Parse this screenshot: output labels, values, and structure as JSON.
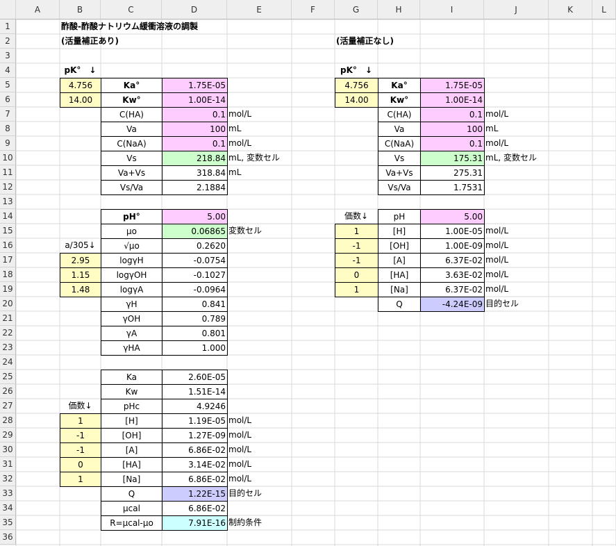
{
  "columns": [
    "A",
    "B",
    "C",
    "D",
    "E",
    "F",
    "G",
    "H",
    "I",
    "J",
    "K",
    "L"
  ],
  "rows": [
    "1",
    "2",
    "3",
    "4",
    "5",
    "6",
    "7",
    "8",
    "9",
    "10",
    "11",
    "12",
    "13",
    "14",
    "15",
    "16",
    "17",
    "18",
    "19",
    "20",
    "21",
    "22",
    "23",
    "24",
    "25",
    "26",
    "27",
    "28",
    "29",
    "30",
    "31",
    "32",
    "33",
    "34",
    "35",
    "36"
  ],
  "colors": {
    "yellow": "#fffcc4",
    "pink": "#ffccff",
    "green": "#ccffcc",
    "blue": "#ccccff",
    "cyan": "#ccffff",
    "header": "#efefef",
    "gridline": "#d4d4d4"
  },
  "left": {
    "title": "酢酸-酢酸ナトリウム緩衝溶液の調製",
    "subtitle": "(活量補正あり)",
    "pk_header": "pK°　↓",
    "pka": "4.756",
    "pkw": "14.00",
    "labels": [
      "Ka°",
      "Kw°",
      "C(HA)",
      "Va",
      "C(NaA)",
      "Vs",
      "Va+Vs",
      "Vs/Va"
    ],
    "values": [
      "1.75E-05",
      "1.00E-14",
      "0.1",
      "100",
      "0.1",
      "218.84",
      "318.84",
      "2.1884"
    ],
    "units": {
      "c_ha": "mol/L",
      "va": "mL",
      "c_naa": "mol/L",
      "vs": "mL, 変数セル",
      "vavs": "mL"
    },
    "ph_label": "pH°",
    "ph_value": "5.00",
    "mu_label": "μo",
    "mu_value": "0.06865",
    "mu_note": "変数セル",
    "a_header": "a/305↓",
    "a_values": [
      "2.95",
      "1.15",
      "1.48"
    ],
    "act_labels": [
      "√μo",
      "logγH",
      "logγOH",
      "logγA",
      "γH",
      "γOH",
      "γA",
      "γHA"
    ],
    "act_values": [
      "0.2620",
      "-0.0754",
      "-0.1027",
      "-0.0964",
      "0.841",
      "0.789",
      "0.801",
      "1.000"
    ],
    "k_labels": [
      "Ka",
      "Kw",
      "pHc"
    ],
    "k_values": [
      "2.60E-05",
      "1.51E-14",
      "4.9246"
    ],
    "valence_header": "価数↓",
    "valences": [
      "1",
      "-1",
      "-1",
      "0",
      "1"
    ],
    "species": [
      "[H]",
      "[OH]",
      "[A]",
      "[HA]",
      "[Na]"
    ],
    "conc": [
      "1.19E-05",
      "1.27E-09",
      "6.86E-02",
      "3.14E-02",
      "6.86E-02"
    ],
    "conc_unit": "mol/L",
    "q_label": "Q",
    "q_value": "1.22E-15",
    "q_note": "目的セル",
    "mucal_label": "μcal",
    "mucal_value": "6.86E-02",
    "r_label": "R=μcal-μo",
    "r_value": "7.91E-16",
    "r_note": "制約条件"
  },
  "right": {
    "subtitle": "(活量補正なし)",
    "pk_header": "pK°　↓",
    "pka": "4.756",
    "pkw": "14.00",
    "labels": [
      "Ka°",
      "Kw°",
      "C(HA)",
      "Va",
      "C(NaA)",
      "Vs",
      "Va+Vs",
      "Vs/Va"
    ],
    "values": [
      "1.75E-05",
      "1.00E-14",
      "0.1",
      "100",
      "0.1",
      "175.31",
      "275.31",
      "1.7531"
    ],
    "units": {
      "c_ha": "mol/L",
      "va": "mL",
      "c_naa": "mol/L",
      "vs": "mL, 変数セル"
    },
    "valence_header": "価数↓",
    "ph_label": "pH",
    "ph_value": "5.00",
    "valences": [
      "1",
      "-1",
      "-1",
      "0",
      "1"
    ],
    "species": [
      "[H]",
      "[OH]",
      "[A]",
      "[HA]",
      "[Na]"
    ],
    "conc": [
      "1.00E-05",
      "1.00E-09",
      "6.37E-02",
      "3.63E-02",
      "6.37E-02"
    ],
    "conc_unit": "mol/L",
    "q_label": "Q",
    "q_value": "-4.24E-09",
    "q_note": "目的セル"
  }
}
